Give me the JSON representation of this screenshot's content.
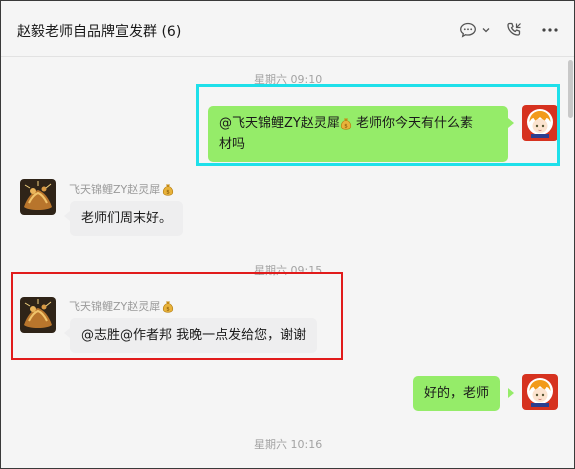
{
  "header": {
    "title": "赵毅老师自品牌宣发群 (6)",
    "icons": [
      "chat-bubble-icon",
      "chevron-down-icon",
      "phone-icon",
      "more-icon"
    ]
  },
  "messages": {
    "t1": "星期六 09:10",
    "m1": "@飞天锦鲤ZY赵灵犀💰 老师你今天有什么素材吗",
    "m1_line1": "@飞天锦鲤ZY赵灵犀",
    "m1_line1b": " 老师你今天有什么素",
    "m1_line2": "材吗",
    "sender2": "飞天锦鲤ZY赵灵犀",
    "m2": "老师们周末好。",
    "t2": "星期六 09:15",
    "sender3": "飞天锦鲤ZY赵灵犀",
    "m3": "@志胜@作者邦 我晚一点发给您，谢谢",
    "m4": "好的，老师",
    "t3": "星期六 10:16"
  },
  "colors": {
    "bubble_me": "#95ec69",
    "bubble_other": "#eeeeef",
    "highlight_cyan": "#1ee0ea",
    "highlight_red": "#e11b1b"
  }
}
